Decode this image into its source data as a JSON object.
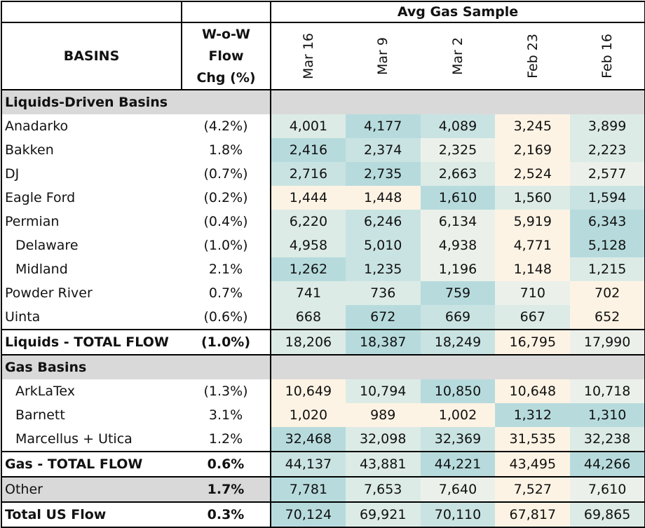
{
  "title": "Avg Gas Sample",
  "header": {
    "basins": "BASINS",
    "chg_line1": "W-o-W Flow",
    "chg_line2": "Chg (%)"
  },
  "dates": [
    "Mar 16",
    "Mar 9",
    "Mar 2",
    "Feb 23",
    "Feb 16"
  ],
  "sections": {
    "liquids": "Liquids-Driven Basins",
    "gas": "Gas Basins"
  },
  "colors": {
    "teal_strong": "#b7dbdd",
    "teal_mid": "#c9e3e2",
    "teal_light": "#dcebe6",
    "neutral": "#ebf1ea",
    "cream": "#fdf3e4",
    "section_grey": "#d9d9d9"
  },
  "liquids_rows": [
    {
      "name": "Anadarko",
      "indent": false,
      "chg": "(4.2%)",
      "values": [
        "4,001",
        "4,177",
        "4,089",
        "3,245",
        "3,899"
      ],
      "shades": [
        "teal_light",
        "teal_strong",
        "teal_mid",
        "cream",
        "teal_light"
      ]
    },
    {
      "name": "Bakken",
      "indent": false,
      "chg": "1.8%",
      "values": [
        "2,416",
        "2,374",
        "2,325",
        "2,169",
        "2,223"
      ],
      "shades": [
        "teal_strong",
        "teal_mid",
        "neutral",
        "cream",
        "teal_light"
      ]
    },
    {
      "name": "DJ",
      "indent": false,
      "chg": "(0.7%)",
      "values": [
        "2,716",
        "2,735",
        "2,663",
        "2,524",
        "2,577"
      ],
      "shades": [
        "teal_mid",
        "teal_strong",
        "teal_light",
        "cream",
        "neutral"
      ]
    },
    {
      "name": "Eagle Ford",
      "indent": false,
      "chg": "(0.2%)",
      "values": [
        "1,444",
        "1,448",
        "1,610",
        "1,560",
        "1,594"
      ],
      "shades": [
        "cream",
        "cream",
        "teal_strong",
        "teal_light",
        "teal_mid"
      ]
    },
    {
      "name": "Permian",
      "indent": false,
      "chg": "(0.4%)",
      "values": [
        "6,220",
        "6,246",
        "6,134",
        "5,919",
        "6,343"
      ],
      "shades": [
        "teal_light",
        "teal_mid",
        "neutral",
        "cream",
        "teal_strong"
      ]
    },
    {
      "name": "Delaware",
      "indent": true,
      "chg": "(1.0%)",
      "values": [
        "4,958",
        "5,010",
        "4,938",
        "4,771",
        "5,128"
      ],
      "shades": [
        "teal_light",
        "teal_mid",
        "neutral",
        "cream",
        "teal_strong"
      ]
    },
    {
      "name": "Midland",
      "indent": true,
      "chg": "2.1%",
      "values": [
        "1,262",
        "1,235",
        "1,196",
        "1,148",
        "1,215"
      ],
      "shades": [
        "teal_strong",
        "teal_mid",
        "neutral",
        "cream",
        "teal_light"
      ]
    },
    {
      "name": "Powder River",
      "indent": false,
      "chg": "0.7%",
      "values": [
        "741",
        "736",
        "759",
        "710",
        "702"
      ],
      "shades": [
        "teal_light",
        "teal_light",
        "teal_strong",
        "neutral",
        "cream"
      ]
    },
    {
      "name": "Uinta",
      "indent": false,
      "chg": "(0.6%)",
      "values": [
        "668",
        "672",
        "669",
        "667",
        "652"
      ],
      "shades": [
        "teal_light",
        "teal_strong",
        "teal_mid",
        "teal_light",
        "cream"
      ]
    }
  ],
  "liquids_total": {
    "name": "Liquids - TOTAL FLOW",
    "chg": "(1.0%)",
    "values": [
      "18,206",
      "18,387",
      "18,249",
      "16,795",
      "17,990"
    ],
    "shades": [
      "teal_light",
      "teal_strong",
      "teal_mid",
      "cream",
      "neutral"
    ]
  },
  "gas_rows": [
    {
      "name": "ArkLaTex",
      "indent": true,
      "chg": "(1.3%)",
      "values": [
        "10,649",
        "10,794",
        "10,850",
        "10,648",
        "10,718"
      ],
      "shades": [
        "cream",
        "teal_light",
        "teal_strong",
        "cream",
        "neutral"
      ]
    },
    {
      "name": "Barnett",
      "indent": true,
      "chg": "3.1%",
      "values": [
        "1,020",
        "989",
        "1,002",
        "1,312",
        "1,310"
      ],
      "shades": [
        "cream",
        "cream",
        "cream",
        "teal_strong",
        "teal_strong"
      ]
    },
    {
      "name": "Marcellus + Utica",
      "indent": true,
      "chg": "1.2%",
      "values": [
        "32,468",
        "32,098",
        "32,369",
        "31,535",
        "32,238"
      ],
      "shades": [
        "teal_strong",
        "teal_light",
        "teal_mid",
        "cream",
        "teal_light"
      ]
    }
  ],
  "gas_total": {
    "name": "Gas - TOTAL FLOW",
    "chg": "0.6%",
    "values": [
      "44,137",
      "43,881",
      "44,221",
      "43,495",
      "44,266"
    ],
    "shades": [
      "teal_mid",
      "teal_light",
      "teal_strong",
      "cream",
      "teal_strong"
    ]
  },
  "other": {
    "name": "Other",
    "chg": "1.7%",
    "values": [
      "7,781",
      "7,653",
      "7,640",
      "7,527",
      "7,610"
    ],
    "shades": [
      "teal_strong",
      "teal_light",
      "neutral",
      "cream",
      "neutral"
    ]
  },
  "grand_total": {
    "name": "Total US Flow",
    "chg": "0.3%",
    "values": [
      "70,124",
      "69,921",
      "70,110",
      "67,817",
      "69,865"
    ],
    "shades": [
      "teal_strong",
      "teal_light",
      "teal_mid",
      "cream",
      "teal_light"
    ]
  }
}
